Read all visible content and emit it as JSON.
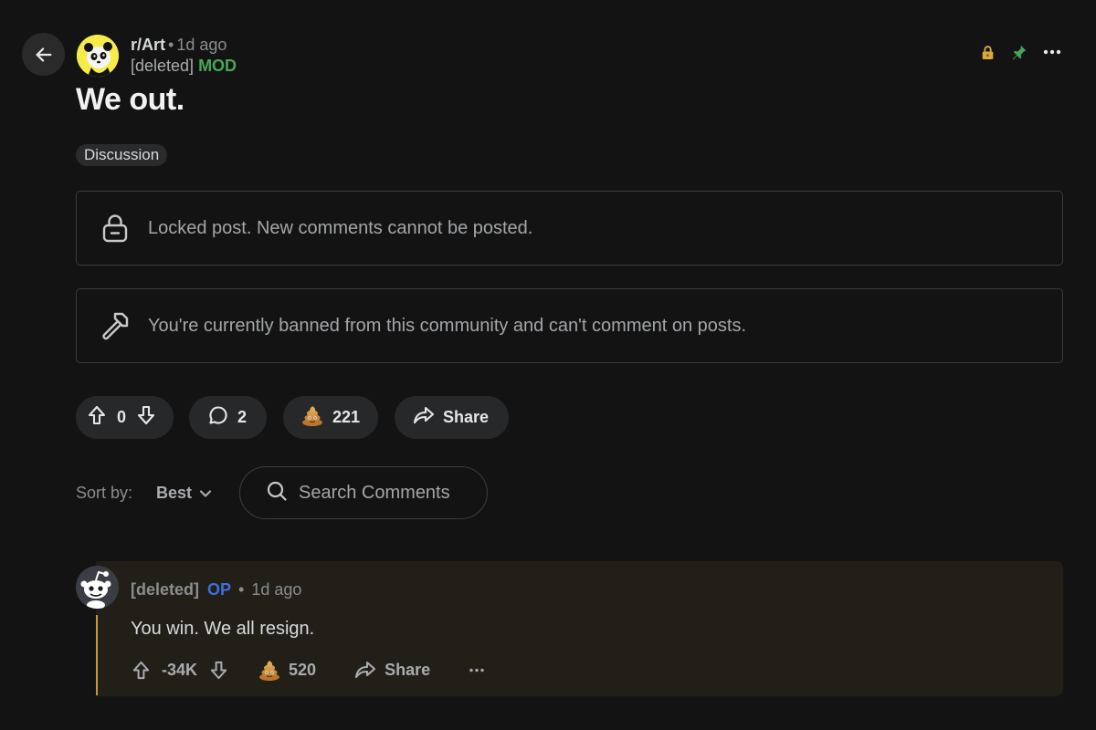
{
  "post": {
    "subreddit": "r/Art",
    "time": "1d ago",
    "author": "[deleted]",
    "author_badge": "MOD",
    "title": "We out.",
    "flair": "Discussion",
    "locked_notice": "Locked post. New comments cannot be posted.",
    "banned_notice": "You're currently banned from this community and can't comment on posts.",
    "score": "0",
    "comment_count": "2",
    "award_count": "221",
    "share_label": "Share"
  },
  "sort": {
    "label": "Sort by:",
    "value": "Best"
  },
  "search": {
    "placeholder": "Search Comments"
  },
  "comment": {
    "author": "[deleted]",
    "badge": "OP",
    "time": "1d ago",
    "body": "You win. We all resign.",
    "score": "-34K",
    "award_count": "520",
    "share_label": "Share"
  },
  "colors": {
    "background": "#131313",
    "mod_green": "#46a758",
    "op_blue": "#3f6fd8",
    "lock_gold": "#d6a93a",
    "pin_green": "#46a758",
    "comment_bg": "#221f19",
    "thread_line": "#c99a39"
  },
  "icons": {
    "back": "arrow-left-icon",
    "lock": "lock-icon",
    "pin": "pin-icon",
    "more": "more-horizontal-icon",
    "upvote": "upvote-icon",
    "downvote": "downvote-icon",
    "comment": "comment-bubble-icon",
    "award": "poop-award-icon",
    "share": "share-arrow-icon",
    "search": "search-icon",
    "chevron": "chevron-down-icon",
    "ban": "ban-hammer-icon"
  }
}
